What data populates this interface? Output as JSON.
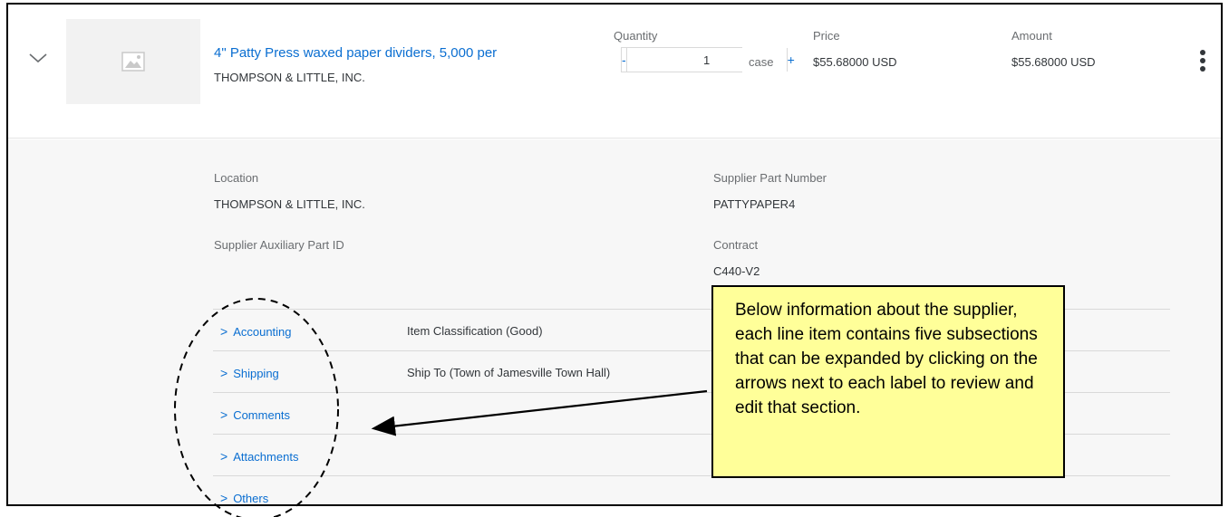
{
  "line_item": {
    "title": "4\" Patty Press waxed paper dividers, 5,000 per",
    "supplier": "THOMPSON & LITTLE, INC.",
    "quantity_label": "Quantity",
    "quantity_value": "1",
    "decrement_label": "-",
    "increment_label": "+",
    "unit": "case",
    "price_label": "Price",
    "price_value": "$55.68000 USD",
    "amount_label": "Amount",
    "amount_value": "$55.68000 USD",
    "icons": {
      "expand": "chevron-down-icon",
      "thumbnail": "image-placeholder-icon",
      "more": "vertical-ellipsis-icon"
    }
  },
  "details": {
    "location_label": "Location",
    "location_value": "THOMPSON & LITTLE, INC.",
    "supplier_part_label": "Supplier Part Number",
    "supplier_part_value": "PATTYPAPER4",
    "aux_part_label": "Supplier Auxiliary Part ID",
    "aux_part_value": "",
    "contract_label": "Contract",
    "contract_value": "C440-V2"
  },
  "sections": [
    {
      "label": "Accounting",
      "info": "Item Classification (Good)"
    },
    {
      "label": "Shipping",
      "info": "Ship To (Town of Jamesville Town Hall)"
    },
    {
      "label": "Comments",
      "info": ""
    },
    {
      "label": "Attachments",
      "info": ""
    },
    {
      "label": "Others",
      "info": ""
    }
  ],
  "callout": {
    "text": "Below information about the supplier, each line item contains five subsections that can be expanded by clicking on the arrows next to each label to review and edit that section."
  },
  "colors": {
    "link": "#0a6ed1",
    "callout_bg": "#ffff99",
    "details_bg": "#f7f7f7"
  }
}
